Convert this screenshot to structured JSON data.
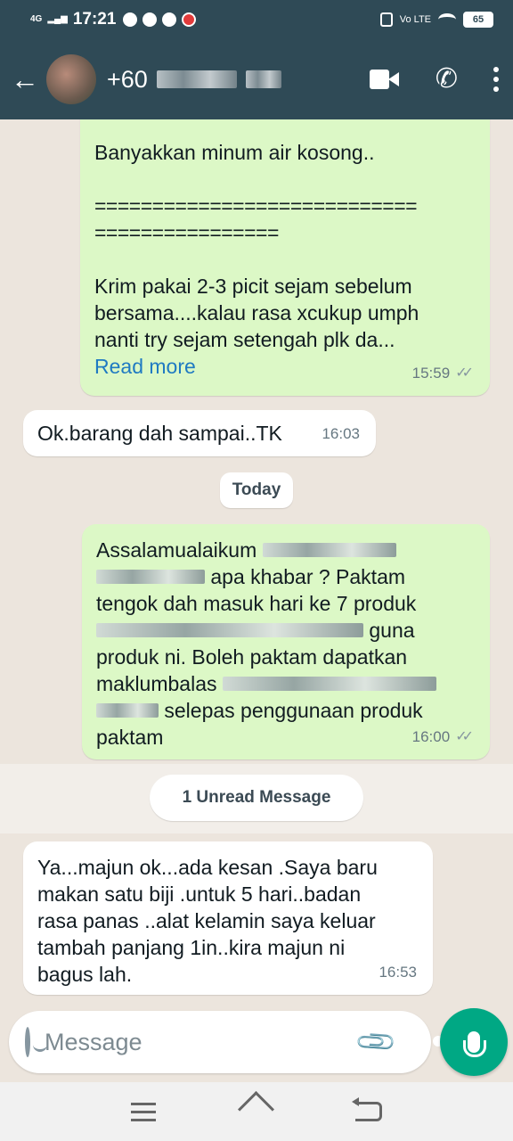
{
  "status_bar": {
    "network": "4G",
    "time": "17:21",
    "volte": "Vo LTE",
    "battery": "65"
  },
  "header": {
    "back_icon": "arrow-left-icon",
    "contact_number_visible": "+60"
  },
  "messages": [
    {
      "direction": "out",
      "lines": [
        "Banyakkan minum air kosong..",
        "",
        "============================",
        "================",
        "",
        "Krim pakai 2-3 picit sejam sebelum",
        "bersama....kalau rasa xcukup umph",
        "nanti try sejam setengah plk da..."
      ],
      "read_more": "Read more",
      "time": "15:59",
      "ticks": "✓✓"
    },
    {
      "direction": "in",
      "text": "Ok.barang dah sampai..TK",
      "time": "16:03"
    },
    {
      "direction": "out",
      "lines": [
        "Assalamualaikum",
        "apa khabar ? Paktam",
        "tengok dah masuk hari ke 7 produk",
        "guna",
        "produk ni. Boleh paktam dapatkan",
        "maklumbalas",
        "selepas penggunaan produk",
        "paktam"
      ],
      "time": "16:00",
      "ticks": "✓✓"
    },
    {
      "direction": "in",
      "lines": [
        "Ya...majun ok...ada kesan .Saya baru",
        "makan satu biji .untuk 5 hari..badan",
        "rasa panas ..alat kelamin saya keluar",
        "tambah panjang 1in..kira majun ni",
        "bagus lah."
      ],
      "time": "16:53"
    }
  ],
  "date_divider": "Today",
  "unread_divider": "1 Unread Message",
  "composer": {
    "placeholder": "Message"
  },
  "colors": {
    "header_bg": "#2f4a56",
    "outgoing_bubble": "#dcf8c6",
    "incoming_bubble": "#ffffff",
    "mic_button": "#00a884",
    "link": "#1f7ac2"
  }
}
